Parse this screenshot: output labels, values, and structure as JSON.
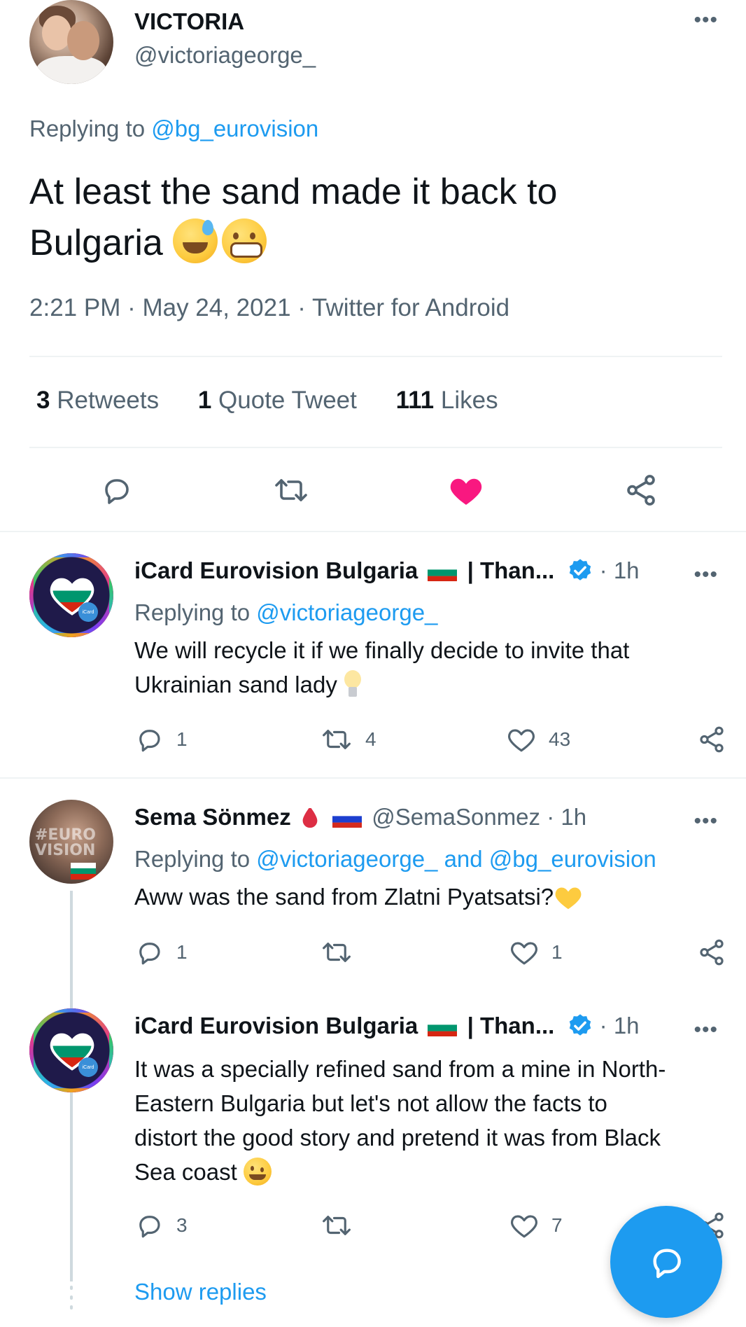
{
  "main_tweet": {
    "display_name": "VICTORIA",
    "handle": "@victoriageorge_",
    "replying_prefix": "Replying to ",
    "replying_to": "@bg_eurovision",
    "text_line1": "At least the sand made it back to",
    "text_line2": "Bulgaria",
    "emojis": [
      "grinning-sweat-emoji",
      "grimacing-emoji"
    ],
    "meta": "2:21 PM · May 24, 2021 · Twitter for Android",
    "stats": {
      "retweets_count": "3",
      "retweets_label": "Retweets",
      "quotes_count": "1",
      "quotes_label": "Quote Tweet",
      "likes_count": "111",
      "likes_label": "Likes"
    },
    "liked": true
  },
  "replies": [
    {
      "display_name": "iCard Eurovision Bulgaria",
      "name_suffix": "| Than...",
      "verified": true,
      "time": "· 1h",
      "replying_prefix": "Replying to ",
      "replying_to": "@victoriageorge_",
      "text_line1": "We will recycle it if we finally decide to invite that",
      "text_line2": "Ukrainian sand lady",
      "reply_count": "1",
      "retweet_count": "4",
      "like_count": "43"
    },
    {
      "display_name": "Sema Sönmez",
      "handle": "@SemaSonmez",
      "time": "· 1h",
      "replying_prefix": "Replying to ",
      "replying_to": "@victoriageorge_ and @bg_eurovision",
      "text": "Aww was the sand from Zlatni Pyatsatsi?",
      "avatar_text": "#EURO VISION",
      "reply_count": "1",
      "retweet_count": "",
      "like_count": "1"
    },
    {
      "display_name": "iCard Eurovision Bulgaria",
      "name_suffix": "| Than...",
      "verified": true,
      "time": "· 1h",
      "text_line1": "It was a specially refined sand from a mine in North-",
      "text_line2": "Eastern Bulgaria but let's not allow the facts to",
      "text_line3": "distort the good story and pretend it was from Black",
      "text_line4": "Sea coast",
      "reply_count": "3",
      "retweet_count": "",
      "like_count": "7"
    }
  ],
  "show_replies": "Show replies",
  "colors": {
    "accent": "#1d9bf0",
    "like_red": "#f91880",
    "secondary_text": "#536471",
    "primary_text": "#0f1419",
    "divider": "#eff3f4"
  }
}
